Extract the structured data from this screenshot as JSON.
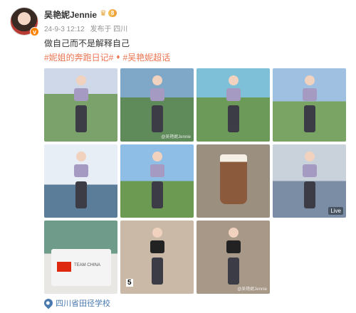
{
  "post": {
    "username": "吴艳妮Jennie",
    "vip_level": "8",
    "date": "24-9-3 12:12",
    "posted_from": "发布于 四川",
    "text": "做自己而不是解释自己",
    "tags": [
      "#妮姐的奔跑日记#",
      "#吴艳妮超话"
    ],
    "location": "四川省田径学校"
  },
  "images": {
    "watermark": "@吴艳妮Jennie",
    "live_badge": "Live",
    "bag_text": "TEAM CHINA",
    "bib_number": "5"
  },
  "colors": {
    "tag": "#eb7350",
    "location": "#4a79b0",
    "meta": "#939393"
  },
  "icons": {
    "verify": "verified-badge-icon",
    "vip": "crown-icon",
    "location": "map-pin-icon"
  }
}
